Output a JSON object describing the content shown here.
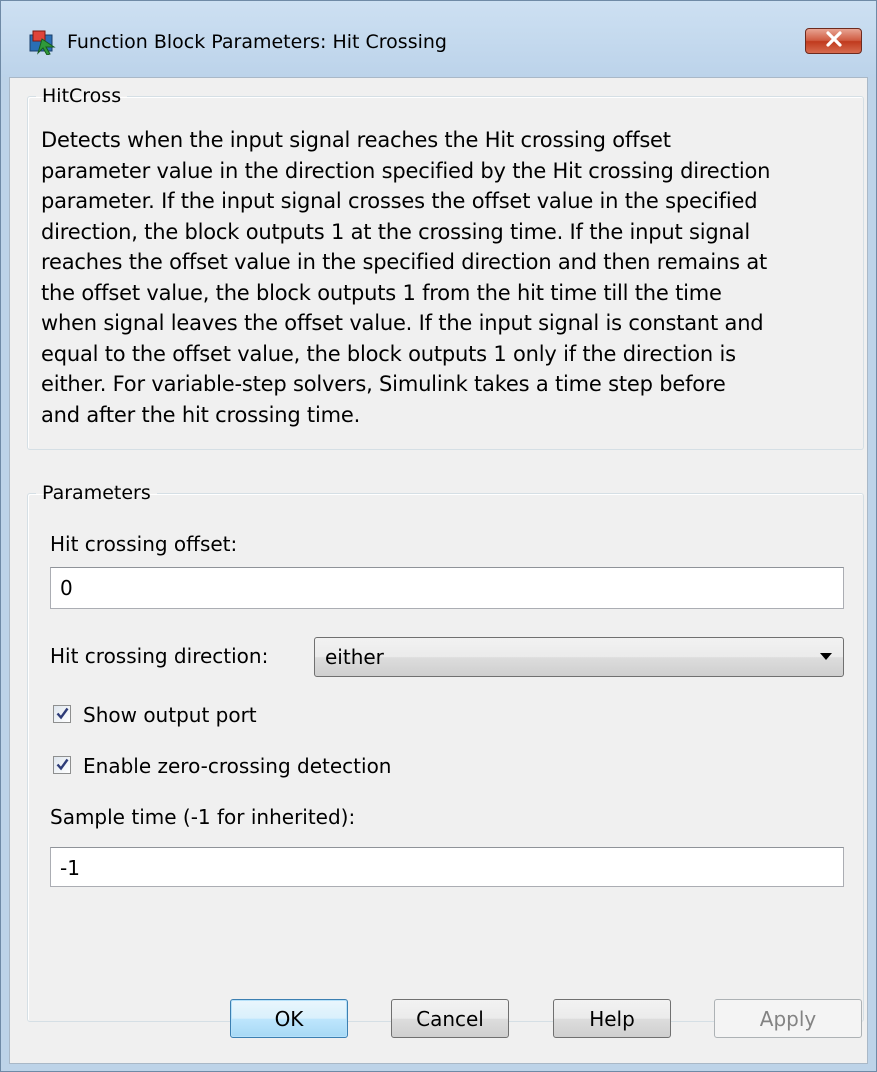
{
  "window": {
    "title": "Function Block Parameters: Hit Crossing",
    "icon": "simulink-block-icon",
    "close_icon": "close-icon",
    "accent_close": "#c7432a"
  },
  "description_group": {
    "legend": "HitCross",
    "text": "Detects when the input signal reaches the Hit crossing offset\nparameter value in the direction specified by the Hit crossing direction\nparameter. If the input signal crosses the offset value in the specified\ndirection, the block outputs 1 at the crossing time. If the input signal\nreaches the offset value in the specified direction and then remains at\nthe offset value, the block outputs 1 from the hit time till the time\nwhen signal leaves the offset value. If the input signal is constant and\nequal to the offset value, the block outputs 1 only if the direction is\neither. For variable-step solvers, Simulink takes a time step before\nand after the hit crossing time."
  },
  "parameters_group": {
    "legend": "Parameters",
    "offset": {
      "label": "Hit crossing offset:",
      "value": "0"
    },
    "direction": {
      "label": "Hit crossing direction:",
      "selected": "either"
    },
    "show_output_port": {
      "label": "Show output port",
      "checked": true
    },
    "zero_crossing": {
      "label": "Enable zero-crossing detection",
      "checked": true
    },
    "sample_time": {
      "label": "Sample time (-1 for inherited):",
      "value": "-1"
    }
  },
  "buttons": {
    "ok": "OK",
    "cancel": "Cancel",
    "help": "Help",
    "apply": "Apply"
  }
}
